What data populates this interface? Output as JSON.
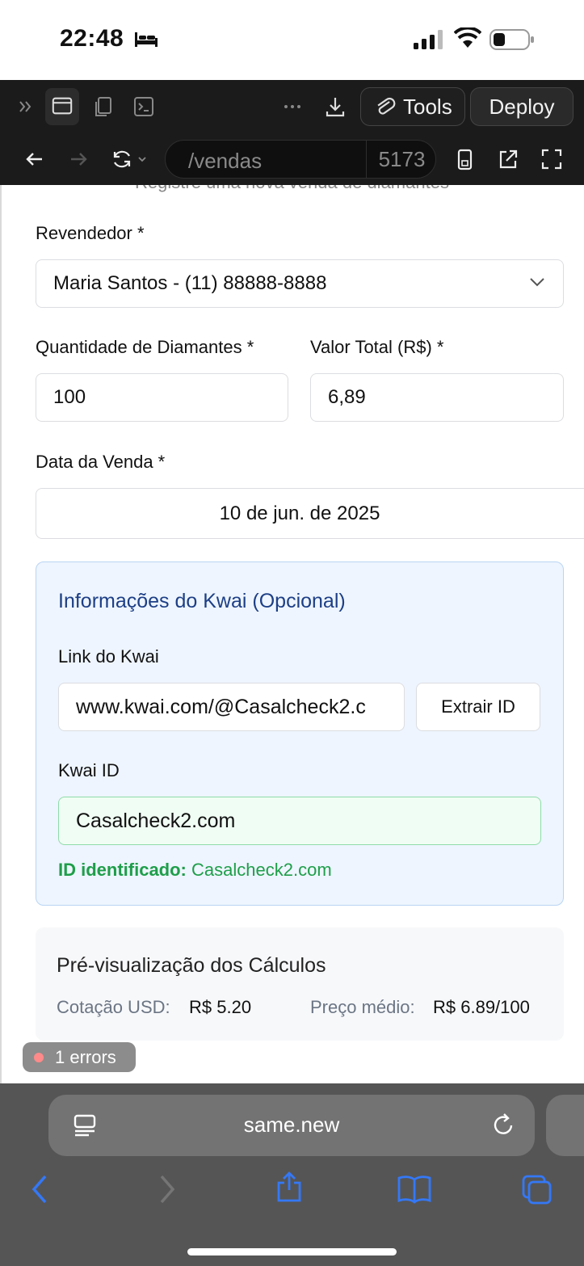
{
  "status_bar": {
    "time": "22:48"
  },
  "dev_toolbar": {
    "tools_label": "Tools",
    "deploy_label": "Deploy"
  },
  "nav_bar": {
    "path": "/vendas",
    "port": "5173"
  },
  "form": {
    "subtitle": "Registre uma nova venda de diamantes",
    "revendedor_label": "Revendedor *",
    "revendedor_value": "Maria Santos - (11) 88888-8888",
    "quantidade_label": "Quantidade de Diamantes *",
    "quantidade_value": "100",
    "valor_label": "Valor Total (R$) *",
    "valor_value": "6,89",
    "data_label": "Data da Venda *",
    "data_value": "10 de jun. de 2025"
  },
  "kwai": {
    "title": "Informações do Kwai (Opcional)",
    "link_label": "Link do Kwai",
    "link_value": "www.kwai.com/@Casalcheck2.c",
    "extract_label": "Extrair ID",
    "id_label": "Kwai ID",
    "id_value": "Casalcheck2.com",
    "id_hint_prefix": "ID identificado:",
    "id_hint_value": "Casalcheck2.com"
  },
  "preview": {
    "title": "Pré-visualização dos Cálculos",
    "cotacao_label": "Cotação USD:",
    "cotacao_value": "R$ 5.20",
    "preco_label": "Preço médio:",
    "preco_value": "R$ 6.89/100"
  },
  "errors_badge": "1 errors",
  "safari": {
    "url": "same.new"
  },
  "colors": {
    "accent_blue": "#1d3f86",
    "success_green": "#1e9e4a",
    "ios_blue": "#3478f6"
  }
}
